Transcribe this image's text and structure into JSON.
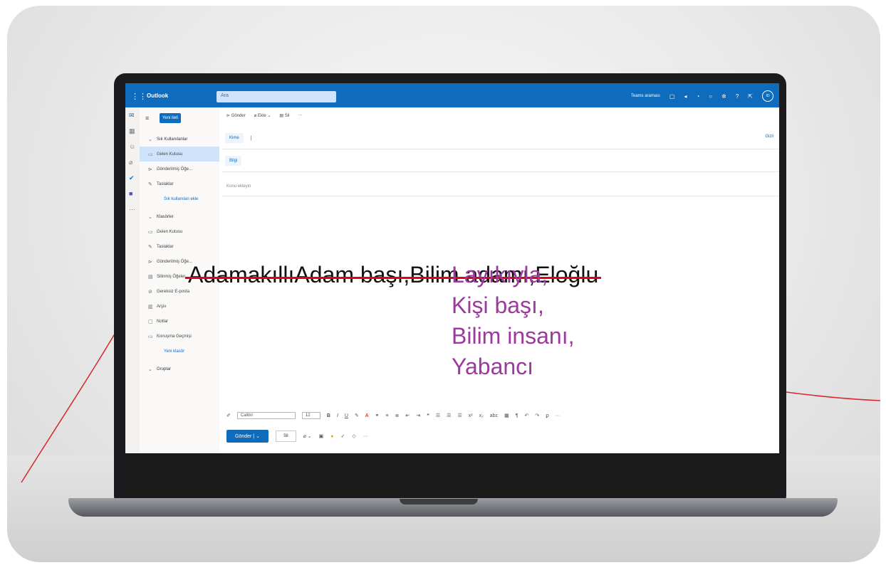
{
  "app": {
    "name": "Outlook",
    "search_placeholder": "Ara",
    "teams_label": "Teams araması",
    "avatar_initials": "ID"
  },
  "sidebar": {
    "new_mail": "Yeni ileti",
    "items": [
      {
        "label": "Sık Kullanılanlar",
        "icon": "chevron-down-icon",
        "kind": "head"
      },
      {
        "label": "Gelen Kutusu",
        "icon": "inbox-icon",
        "kind": "selected"
      },
      {
        "label": "Gönderilmiş Öğe...",
        "icon": "send-icon",
        "kind": "item"
      },
      {
        "label": "Taslaklar",
        "icon": "pencil-icon",
        "kind": "item"
      },
      {
        "label": "Sık kullanılan ekle",
        "icon": "",
        "kind": "sub"
      },
      {
        "label": "Klasörler",
        "icon": "chevron-down-icon",
        "kind": "head"
      },
      {
        "label": "Gelen Kutusu",
        "icon": "inbox-icon",
        "kind": "item"
      },
      {
        "label": "Taslaklar",
        "icon": "pencil-icon",
        "kind": "item"
      },
      {
        "label": "Gönderilmiş Öğe...",
        "icon": "send-icon",
        "kind": "item"
      },
      {
        "label": "Silinmiş Öğeler",
        "icon": "trash-icon",
        "kind": "item"
      },
      {
        "label": "Gereksiz E-posta",
        "icon": "blocked-icon",
        "kind": "item"
      },
      {
        "label": "Arşiv",
        "icon": "archive-icon",
        "kind": "item"
      },
      {
        "label": "Notlar",
        "icon": "note-icon",
        "kind": "item"
      },
      {
        "label": "Konuşma Geçmişi",
        "icon": "folder-icon",
        "kind": "item"
      },
      {
        "label": "Yeni klasör",
        "icon": "",
        "kind": "sub"
      },
      {
        "label": "Gruplar",
        "icon": "chevron-down-icon",
        "kind": "head"
      }
    ]
  },
  "toolbar": {
    "send": "Gönder",
    "attach": "Ekle",
    "delete": "Sil"
  },
  "compose": {
    "to_label": "Kime",
    "cc_label": "Bilgi",
    "bcc_label": "Gizli",
    "subject_placeholder": "Konu ekleyin"
  },
  "message": {
    "struck_words": [
      "Adamakıllı",
      "Adam başı,",
      "Bilim adamı,",
      "Eloğlu"
    ],
    "replacement_words": [
      "Layıkıyla,",
      "Kişi başı,",
      "Bilim insanı,",
      "Yabancı"
    ],
    "strike_color": "#e4001b",
    "replacement_color": "#9b3a9c"
  },
  "format": {
    "font": "Calibri",
    "size": "12"
  },
  "send_row": {
    "send": "Gönder",
    "discard": "Sil"
  },
  "colors": {
    "accent": "#0f6cbd",
    "deco_line": "#d9272e"
  }
}
